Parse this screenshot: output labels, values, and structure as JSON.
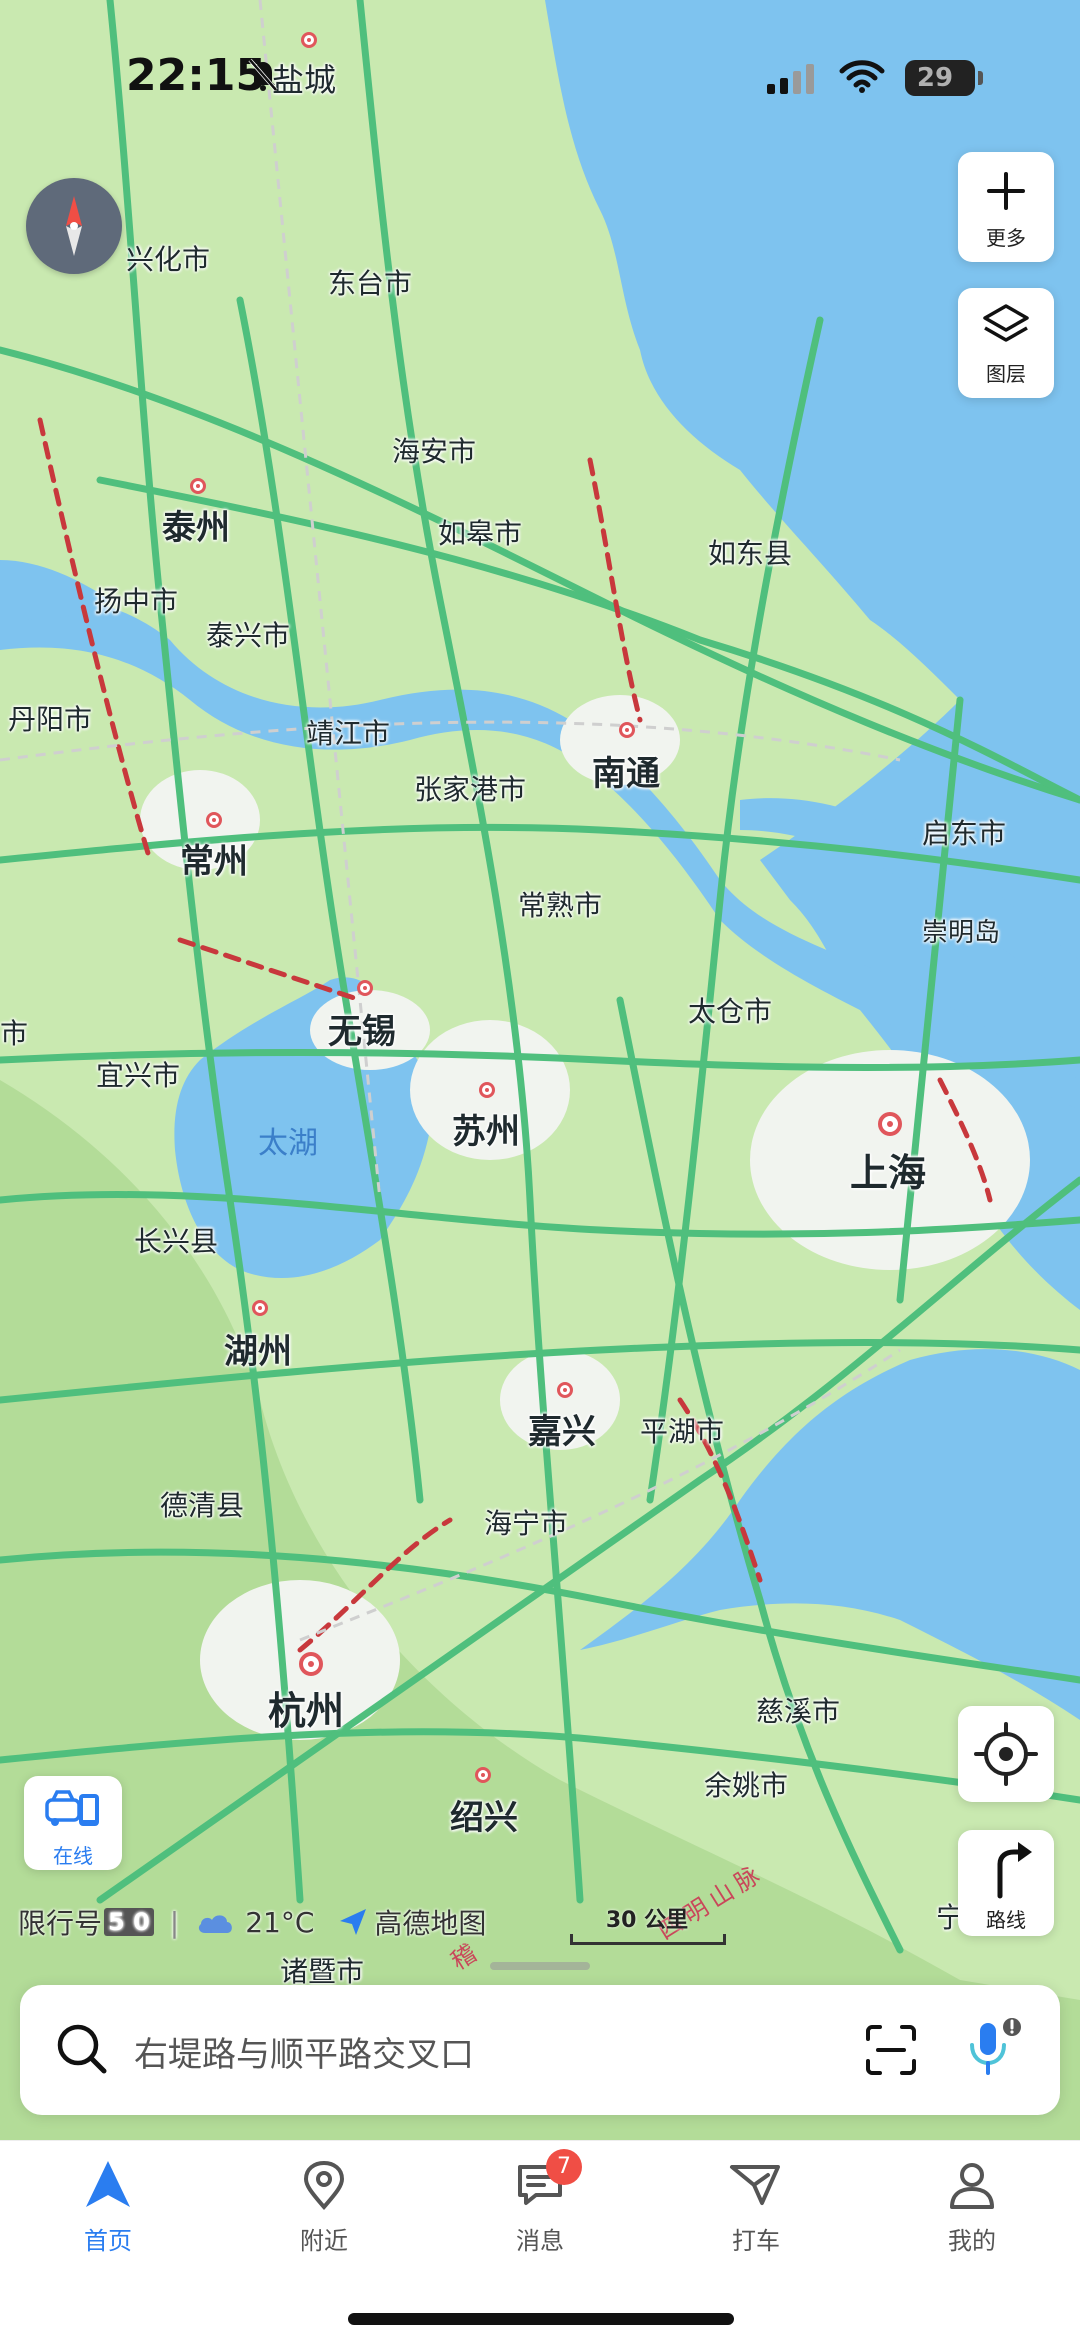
{
  "status_bar": {
    "time": "22:15",
    "battery": "29"
  },
  "map": {
    "side_buttons": {
      "more": "更多",
      "layers": "图层"
    },
    "online_label": "在线",
    "route_label": "路线",
    "places": {
      "yancheng": "盐城",
      "xinghua": "兴化市",
      "dongtai": "东台市",
      "haian": "海安市",
      "taizhou": "泰州",
      "rugao": "如皋市",
      "rudong": "如东县",
      "yangzhong": "扬中市",
      "taixing": "泰兴市",
      "danyang": "丹阳市",
      "jingjiang": "靖江市",
      "nantong": "南通",
      "zhangjiagang": "张家港市",
      "changzhou": "常州",
      "qidong": "启东市",
      "changshu": "常熟市",
      "chongming": "崇明岛",
      "taicang": "太仓市",
      "wuxi": "无锡",
      "yixing": "宜兴市",
      "taihu": "太湖",
      "suzhou": "苏州",
      "shanghai": "上海",
      "changxing": "长兴县",
      "huzhou": "湖州",
      "jiaxing": "嘉兴",
      "pinghu": "平湖市",
      "deqing": "德清县",
      "haining": "海宁市",
      "hangzhou": "杭州",
      "cixi": "慈溪市",
      "yuyao": "余姚市",
      "shaoxing": "绍兴",
      "zhuji": "诸暨市",
      "edge_left": "市",
      "edge_right": "宁",
      "siming_mountain": "四明山脉",
      "kuaiji": "稽"
    },
    "footer": {
      "restriction_label": "限行号",
      "restriction_plates": "5 0",
      "temperature": "21°C",
      "provider": "高德地图"
    },
    "scale": "30 公里"
  },
  "search": {
    "placeholder": "右堤路与顺平路交叉口"
  },
  "tabs": [
    {
      "label": "首页"
    },
    {
      "label": "附近"
    },
    {
      "label": "消息",
      "badge": "7"
    },
    {
      "label": "打车"
    },
    {
      "label": "我的"
    }
  ],
  "colors": {
    "accent": "#2a7df0",
    "road": "#4fbf7d",
    "water": "#7ec3ef",
    "land": "#c9e9b0",
    "congestion": "#c8383c"
  }
}
